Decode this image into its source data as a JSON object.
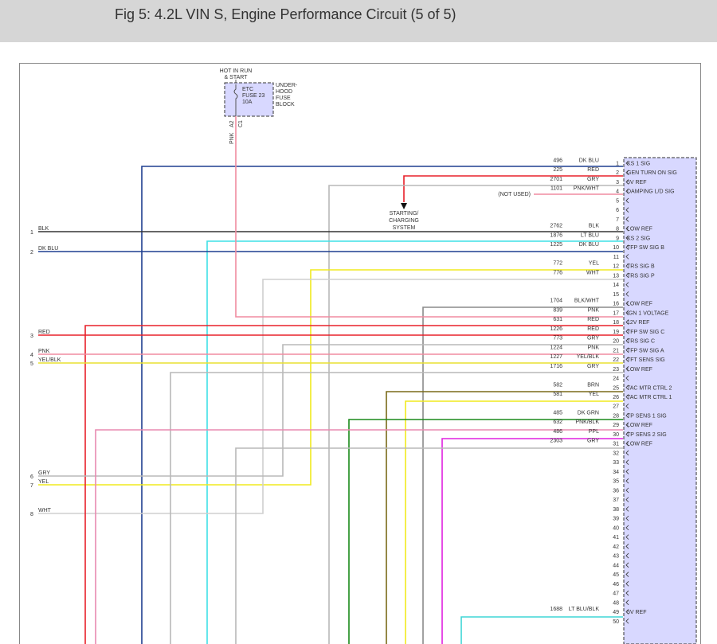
{
  "header": {
    "title": "Fig 5: 4.2L VIN S, Engine Performance Circuit (5 of 5)"
  },
  "fuse": {
    "supply_line1": "HOT IN RUN",
    "supply_line2": "& START",
    "name_line1": "ETC",
    "name_line2": "FUSE 23",
    "name_line3": "10A",
    "block_line1": "UNDER-",
    "block_line2": "HOOD",
    "block_line3": "FUSE",
    "block_line4": "BLOCK",
    "pin_a": "A2",
    "pin_c": "C1",
    "out_wire": "PNK"
  },
  "starting_system": {
    "line1": "STARTING/",
    "line2": "CHARGING",
    "line3": "SYSTEM"
  },
  "not_used_label": "(NOT USED)",
  "colors": {
    "DK BLU": "#1f3f8f",
    "RED": "#e8202a",
    "GRY": "#b8b8b8",
    "PNK/WHT": "#f08ca0",
    "BLK": "#333333",
    "LT BLU": "#3fe0e6",
    "YEL": "#f0ea1e",
    "WHT": "#cfcfcf",
    "BLK/WHT": "#8a8a8a",
    "PNK": "#f08ca0",
    "YEL/BLK": "#e8e030",
    "BRN": "#7a6a18",
    "DK GRN": "#1a8a1a",
    "PNK/BLK": "#e88ab0",
    "PPL": "#e020e0",
    "LT BLU/BLK": "#3fd6d6",
    "connector_fill": "#d8d8ff"
  },
  "pins": [
    {
      "num": "1",
      "circuit": "496",
      "color": "DK BLU",
      "signal": "KS 1 SIG"
    },
    {
      "num": "2",
      "circuit": "225",
      "color": "RED",
      "signal": "GEN TURN ON SIG"
    },
    {
      "num": "3",
      "circuit": "2701",
      "color": "GRY",
      "signal": "5V REF"
    },
    {
      "num": "4",
      "circuit": "1101",
      "color": "PNK/WHT",
      "signal": "DAMPING L/D SIG"
    },
    {
      "num": "5",
      "circuit": "",
      "color": "",
      "signal": ""
    },
    {
      "num": "6",
      "circuit": "",
      "color": "",
      "signal": ""
    },
    {
      "num": "7",
      "circuit": "",
      "color": "",
      "signal": ""
    },
    {
      "num": "8",
      "circuit": "2762",
      "color": "BLK",
      "signal": "LOW REF"
    },
    {
      "num": "9",
      "circuit": "1876",
      "color": "LT BLU",
      "signal": "KS 2 SIG"
    },
    {
      "num": "10",
      "circuit": "1225",
      "color": "DK BLU",
      "signal": "TFP SW SIG B"
    },
    {
      "num": "11",
      "circuit": "",
      "color": "",
      "signal": ""
    },
    {
      "num": "12",
      "circuit": "772",
      "color": "YEL",
      "signal": "TRS SIG B"
    },
    {
      "num": "13",
      "circuit": "776",
      "color": "WHT",
      "signal": "TRS SIG P"
    },
    {
      "num": "14",
      "circuit": "",
      "color": "",
      "signal": ""
    },
    {
      "num": "15",
      "circuit": "",
      "color": "",
      "signal": ""
    },
    {
      "num": "16",
      "circuit": "1704",
      "color": "BLK/WHT",
      "signal": "LOW REF"
    },
    {
      "num": "17",
      "circuit": "839",
      "color": "PNK",
      "signal": "IGN 1 VOLTAGE"
    },
    {
      "num": "18",
      "circuit": "631",
      "color": "RED",
      "signal": "12V REF"
    },
    {
      "num": "19",
      "circuit": "1226",
      "color": "RED",
      "signal": "TFP SW SIG C"
    },
    {
      "num": "20",
      "circuit": "773",
      "color": "GRY",
      "signal": "TRS SIG C"
    },
    {
      "num": "21",
      "circuit": "1224",
      "color": "PNK",
      "signal": "TFP SW SIG A"
    },
    {
      "num": "22",
      "circuit": "1227",
      "color": "YEL/BLK",
      "signal": "TFT SENS SIG"
    },
    {
      "num": "23",
      "circuit": "1716",
      "color": "GRY",
      "signal": "LOW REF"
    },
    {
      "num": "24",
      "circuit": "",
      "color": "",
      "signal": ""
    },
    {
      "num": "25",
      "circuit": "582",
      "color": "BRN",
      "signal": "TAC MTR CTRL 2"
    },
    {
      "num": "26",
      "circuit": "581",
      "color": "YEL",
      "signal": "TAC MTR CTRL 1"
    },
    {
      "num": "27",
      "circuit": "",
      "color": "",
      "signal": ""
    },
    {
      "num": "28",
      "circuit": "485",
      "color": "DK GRN",
      "signal": "TP SENS 1 SIG"
    },
    {
      "num": "29",
      "circuit": "632",
      "color": "PNK/BLK",
      "signal": "LOW REF"
    },
    {
      "num": "30",
      "circuit": "486",
      "color": "PPL",
      "signal": "TP SENS 2 SIG"
    },
    {
      "num": "31",
      "circuit": "2303",
      "color": "GRY",
      "signal": "LOW REF"
    },
    {
      "num": "32",
      "circuit": "",
      "color": "",
      "signal": ""
    },
    {
      "num": "33",
      "circuit": "",
      "color": "",
      "signal": ""
    },
    {
      "num": "34",
      "circuit": "",
      "color": "",
      "signal": ""
    },
    {
      "num": "35",
      "circuit": "",
      "color": "",
      "signal": ""
    },
    {
      "num": "36",
      "circuit": "",
      "color": "",
      "signal": ""
    },
    {
      "num": "37",
      "circuit": "",
      "color": "",
      "signal": ""
    },
    {
      "num": "38",
      "circuit": "",
      "color": "",
      "signal": ""
    },
    {
      "num": "39",
      "circuit": "",
      "color": "",
      "signal": ""
    },
    {
      "num": "40",
      "circuit": "",
      "color": "",
      "signal": ""
    },
    {
      "num": "41",
      "circuit": "",
      "color": "",
      "signal": ""
    },
    {
      "num": "42",
      "circuit": "",
      "color": "",
      "signal": ""
    },
    {
      "num": "43",
      "circuit": "",
      "color": "",
      "signal": ""
    },
    {
      "num": "44",
      "circuit": "",
      "color": "",
      "signal": ""
    },
    {
      "num": "45",
      "circuit": "",
      "color": "",
      "signal": ""
    },
    {
      "num": "46",
      "circuit": "",
      "color": "",
      "signal": ""
    },
    {
      "num": "47",
      "circuit": "",
      "color": "",
      "signal": ""
    },
    {
      "num": "48",
      "circuit": "",
      "color": "",
      "signal": ""
    },
    {
      "num": "49",
      "circuit": "1688",
      "color": "LT BLU/BLK",
      "signal": "5V REF"
    },
    {
      "num": "50",
      "circuit": "",
      "color": "",
      "signal": ""
    }
  ],
  "left_connections": [
    {
      "num": "1",
      "color": "BLK"
    },
    {
      "num": "2",
      "color": "DK BLU"
    },
    {
      "num": "3",
      "color": "RED"
    },
    {
      "num": "4",
      "color": "PNK"
    },
    {
      "num": "5",
      "color": "YEL/BLK"
    },
    {
      "num": "6",
      "color": "GRY"
    },
    {
      "num": "7",
      "color": "YEL"
    },
    {
      "num": "8",
      "color": "WHT"
    }
  ]
}
